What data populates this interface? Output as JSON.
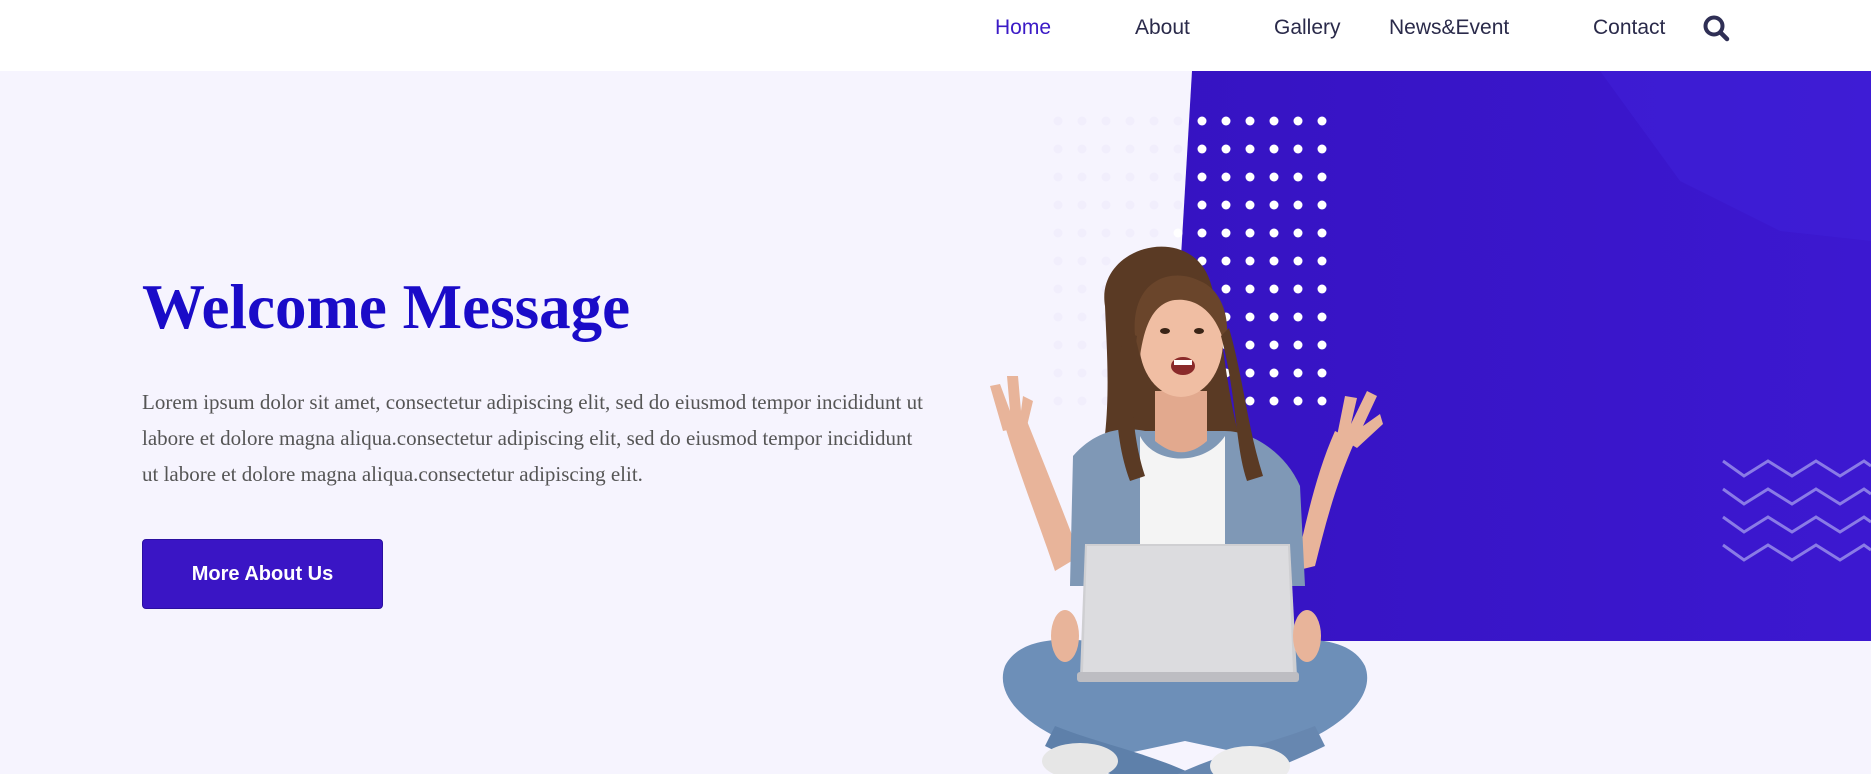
{
  "nav": {
    "items": [
      {
        "label": "Home",
        "active": true
      },
      {
        "label": "About",
        "active": false
      },
      {
        "label": "Gallery",
        "active": false
      },
      {
        "label": "News&Event",
        "active": false
      },
      {
        "label": "Contact",
        "active": false
      }
    ],
    "search_icon": "search-icon"
  },
  "hero": {
    "title": "Welcome Message",
    "description": "Lorem ipsum dolor sit amet, consectetur adipiscing elit, sed do eiusmod tempor incididunt ut labore et dolore magna aliqua.consectetur adipiscing elit, sed do eiusmod tempor incididunt ut labore et dolore magna aliqua.consectetur adipiscing elit.",
    "cta_label": "More About Us"
  },
  "colors": {
    "accent": "#3b1ac6",
    "title": "#1a0bc8",
    "hero_background": "#f6f4fe",
    "purple_panel": "#3a16c6"
  }
}
